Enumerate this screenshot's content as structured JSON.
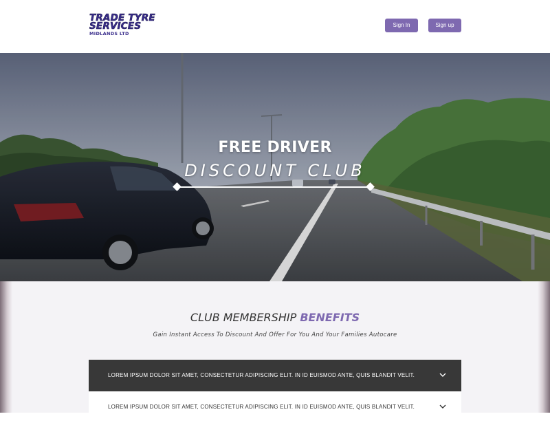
{
  "header": {
    "logo": {
      "line1": "TRADE TYRE",
      "line2": "SERVICES",
      "line3": "MIDLANDS LTD"
    },
    "signin_label": "Sign In",
    "signup_label": "Sign up"
  },
  "hero": {
    "title": "FREE DRIVER",
    "subtitle": "DISCOUNT CLUB"
  },
  "benefits": {
    "title_prefix": "CLUB MEMBERSHIP",
    "title_highlight": "BENEFITS",
    "subtitle": "Gain Instant Access To Discount And Offer For You And Your Families Autocare",
    "items": [
      {
        "text": "LOREM IPSUM DOLOR SIT AMET, CONSECTETUR ADIPISCING ELIT. IN ID EUISMOD ANTE, QUIS BLANDIT VELIT.",
        "state": "active"
      },
      {
        "text": "LOREM IPSUM DOLOR SIT AMET, CONSECTETUR ADIPISCING ELIT. IN ID EUISMOD ANTE, QUIS BLANDIT VELIT.",
        "state": "collapsed"
      }
    ]
  },
  "colors": {
    "accent": "#7e69b0",
    "logo": "#3a2e8c",
    "accordion_active": "#383838",
    "section_bg": "#f4f3f6"
  },
  "icons": {
    "accordion": "chevron-down-icon"
  }
}
